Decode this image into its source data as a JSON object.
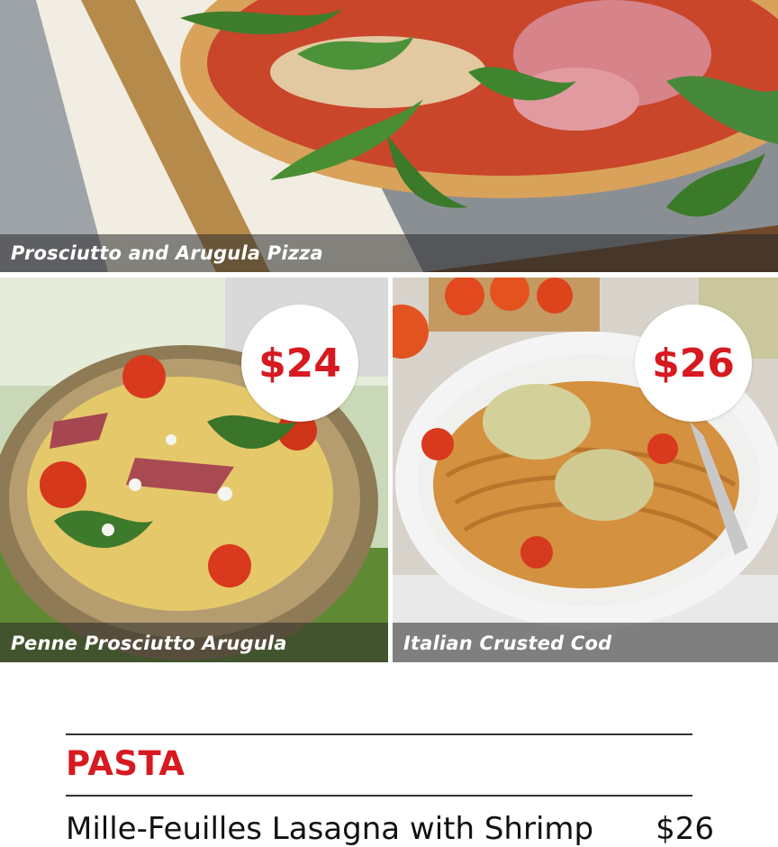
{
  "gallery": {
    "tiles": [
      {
        "caption": "Prosciutto and Arugula Pizza"
      },
      {
        "caption": "Penne Prosciutto Arugula",
        "price": "$24"
      },
      {
        "caption": "Italian Crusted Cod",
        "price": "$26"
      }
    ]
  },
  "menu": {
    "section_title": "PASTA",
    "items": [
      {
        "name": "Mille-Feuilles Lasagna with Shrimp",
        "price": "$26"
      }
    ]
  },
  "colors": {
    "accent": "#d71920",
    "caption_overlay": "#282828",
    "text": "#111111"
  }
}
